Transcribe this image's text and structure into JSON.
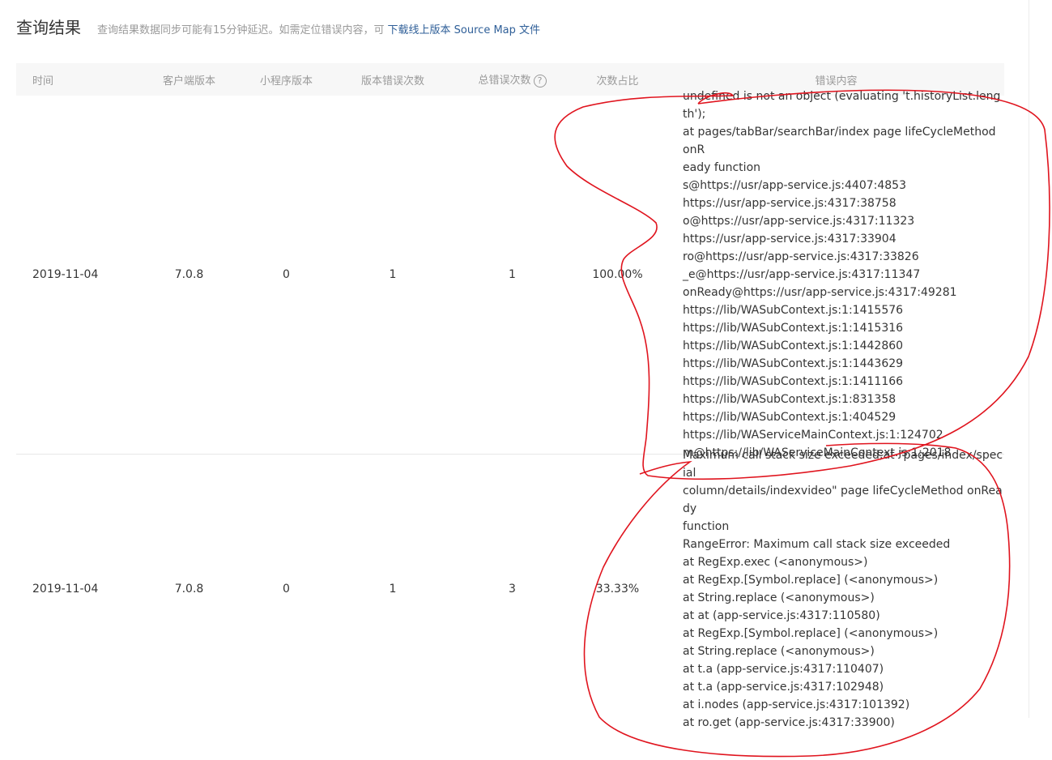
{
  "header": {
    "title": "查询结果",
    "notice": "查询结果数据同步可能有15分钟延迟。如需定位错误内容，可",
    "link_text": "下载线上版本 Source Map 文件"
  },
  "table": {
    "columns": {
      "time": "时间",
      "client_version": "客户端版本",
      "miniprogram_version": "小程序版本",
      "version_errors": "版本错误次数",
      "total_errors": "总错误次数",
      "ratio": "次数占比",
      "content": "错误内容"
    },
    "help_glyph": "?",
    "rows": [
      {
        "time": "2019-11-04",
        "client_version": "7.0.8",
        "miniprogram_version": "0",
        "version_errors": "1",
        "total_errors": "1",
        "ratio": "100.00%",
        "content": [
          "undefined is not an object (evaluating 't.historyList.length');",
          "at pages/tabBar/searchBar/index page lifeCycleMethod onR",
          "eady function",
          "s@https://usr/app-service.js:4407:4853",
          "https://usr/app-service.js:4317:38758",
          "o@https://usr/app-service.js:4317:11323",
          "https://usr/app-service.js:4317:33904",
          "ro@https://usr/app-service.js:4317:33826",
          "_e@https://usr/app-service.js:4317:11347",
          "onReady@https://usr/app-service.js:4317:49281",
          "https://lib/WASubContext.js:1:1415576",
          "https://lib/WASubContext.js:1:1415316",
          "https://lib/WASubContext.js:1:1442860",
          "https://lib/WASubContext.js:1:1443629",
          "https://lib/WASubContext.js:1:1411166",
          "https://lib/WASubContext.js:1:831358",
          "https://lib/WASubContext.js:1:404529",
          "https://lib/WAServiceMainContext.js:1:124702",
          "m@https://lib/WAServiceMainContext.js:1:2018"
        ]
      },
      {
        "time": "2019-11-04",
        "client_version": "7.0.8",
        "miniprogram_version": "0",
        "version_errors": "1",
        "total_errors": "3",
        "ratio": "33.33%",
        "content": [
          "Maximum call stack size exceeded;at \"pages/index/special_",
          "column/details/indexvideo\" page lifeCycleMethod onReady",
          "function",
          "RangeError: Maximum call stack size exceeded",
          "at RegExp.exec (<anonymous>)",
          "at RegExp.[Symbol.replace] (<anonymous>)",
          "at String.replace (<anonymous>)",
          "at at (app-service.js:4317:110580)",
          "at RegExp.[Symbol.replace] (<anonymous>)",
          "at String.replace (<anonymous>)",
          "at t.a (app-service.js:4317:110407)",
          "at t.a (app-service.js:4317:102948)",
          "at i.nodes (app-service.js:4317:101392)",
          "at ro.get (app-service.js:4317:33900)"
        ]
      }
    ]
  },
  "colors": {
    "link": "#2f5f98",
    "header_bg": "#f7f7f7",
    "annotation": "#e0141e",
    "muted_text": "#9a9a9a"
  }
}
